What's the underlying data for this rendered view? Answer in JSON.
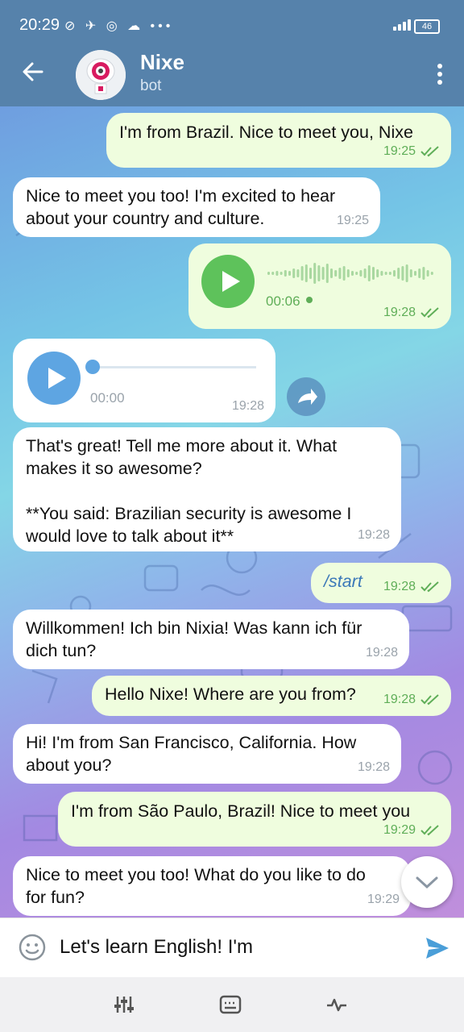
{
  "status_bar": {
    "time": "20:29",
    "icons": "⊘ ✈ ◎ ☁ •••",
    "battery": "46"
  },
  "header": {
    "title": "Nixe",
    "subtitle": "bot"
  },
  "messages": [
    {
      "dir": "out",
      "text": "I'm from Brazil. Nice to meet you, Nixe",
      "time": "19:25"
    },
    {
      "dir": "in",
      "text": "Nice to meet you too! I'm excited to hear\nabout your country and culture.",
      "time": "19:25"
    },
    {
      "dir": "out",
      "type": "voice",
      "duration": "00:06",
      "time": "19:28"
    },
    {
      "dir": "in",
      "type": "audio",
      "duration": "00:00",
      "time": "19:28"
    },
    {
      "dir": "in",
      "text": "That's great! Tell me more about it. What\nmakes it so awesome?\n\n**You said: Brazilian security is awesome I\nwould love to talk about it**",
      "time": "19:28"
    },
    {
      "dir": "out",
      "text": "/start",
      "time": "19:28"
    },
    {
      "dir": "in",
      "text": "Willkommen! Ich bin Nixia! Was kann ich für\ndich tun?",
      "time": "19:28"
    },
    {
      "dir": "out",
      "text": "Hello Nixe! Where are you from?",
      "time": "19:28"
    },
    {
      "dir": "in",
      "text": "Hi! I'm from San Francisco, California. How\nabout you?",
      "time": "19:28"
    },
    {
      "dir": "out",
      "text": "I'm from São Paulo, Brazil! Nice to meet you",
      "time": "19:29"
    },
    {
      "dir": "in",
      "text": "Nice to meet you too! What do you like to do\nfor fun?",
      "time": "19:29"
    }
  ],
  "composer": {
    "value": "Let's learn English! I'm"
  },
  "colors": {
    "header": "#5682ab",
    "outgoing": "#effdde",
    "incoming": "#ffffff",
    "accent_green": "#5fae58",
    "send_blue": "#4a9ed8"
  }
}
